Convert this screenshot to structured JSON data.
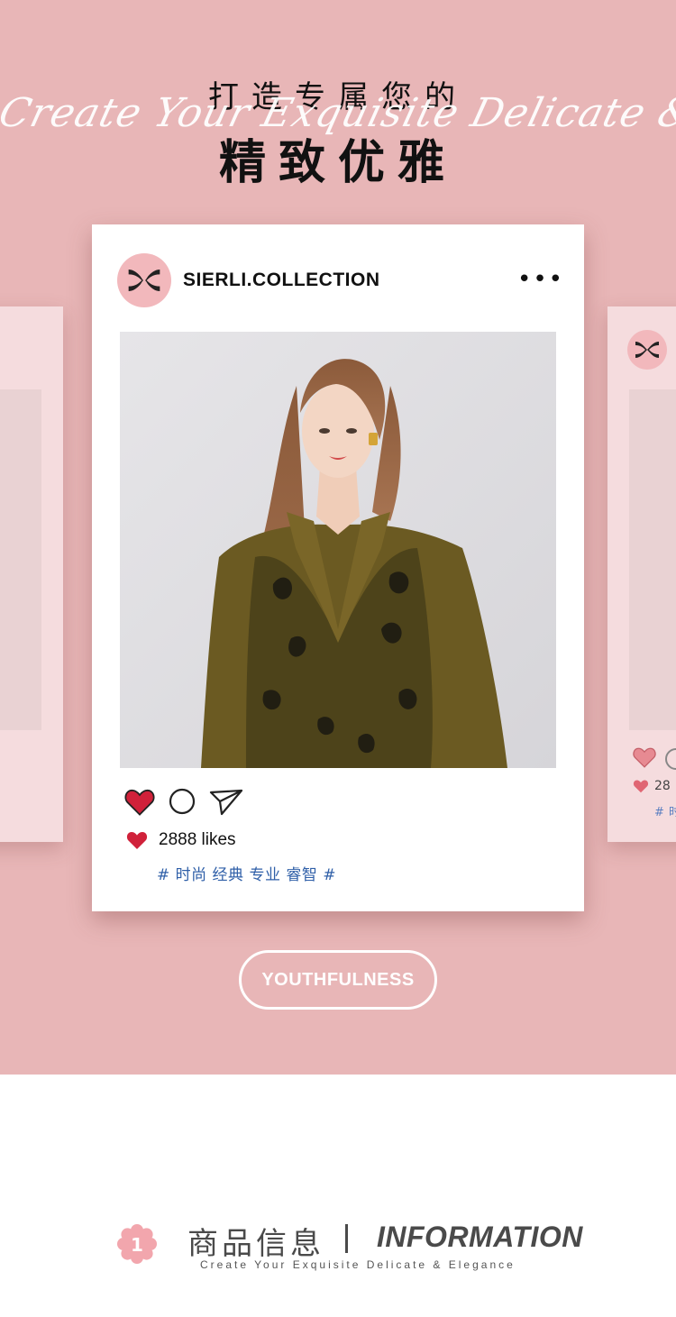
{
  "header": {
    "title_line1": "打造专属您的",
    "title_line2": "精致优雅",
    "script_text": "Create Your Exquisite Delicate & Elegance"
  },
  "post": {
    "handle": "SIERLI.COLLECTION",
    "more_icon": "•••",
    "likes": "2888 likes",
    "tags": "# 时尚 经典 专业 睿智 #"
  },
  "side_post": {
    "likes": "28",
    "tags": "# 时"
  },
  "cta": {
    "label": "YOUTHFULNESS"
  },
  "info": {
    "title_cn": "商品信息",
    "title_en": "INFORMATION",
    "subtitle": "Create Your Exquisite Delicate & Elegance",
    "badge_number": "1"
  },
  "colors": {
    "background_pink": "#e8b6b7",
    "avatar_pink": "#f2b8bc",
    "heart_red": "#d0213a",
    "tag_blue": "#2f5fa8",
    "text_dark": "#111111",
    "info_gray": "#4a4a4a"
  },
  "icons": [
    "logo-icon",
    "more-icon",
    "heart-icon",
    "comment-icon",
    "send-icon",
    "flower-badge-icon"
  ]
}
